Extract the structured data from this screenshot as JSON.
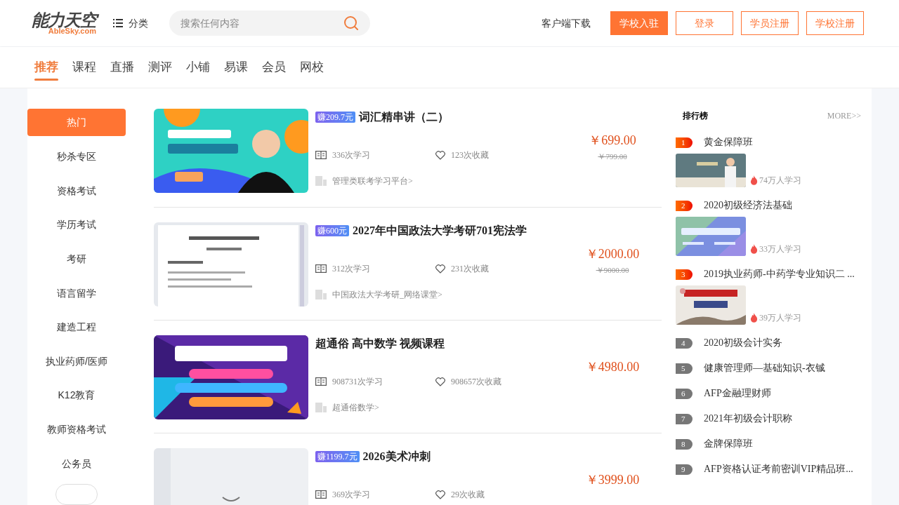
{
  "header": {
    "logo": {
      "name": "能力天空",
      "domain": "AbleSky.com"
    },
    "category_button": "分类",
    "search": {
      "placeholder": "搜索任何内容"
    },
    "download_link": "客户端下载",
    "buttons": [
      {
        "label": "学校入驻",
        "kind": "primary"
      },
      {
        "label": "登录",
        "kind": "outline"
      },
      {
        "label": "学员注册",
        "kind": "outline"
      },
      {
        "label": "学校注册",
        "kind": "outline"
      }
    ]
  },
  "nav_tabs": [
    {
      "label": "推荐",
      "selected": true
    },
    {
      "label": "课程",
      "selected": false
    },
    {
      "label": "直播",
      "selected": false
    },
    {
      "label": "测评",
      "selected": false
    },
    {
      "label": "小铺",
      "selected": false
    },
    {
      "label": "易课",
      "selected": false
    },
    {
      "label": "会员",
      "selected": false
    },
    {
      "label": "网校",
      "selected": false
    }
  ],
  "sidebar": {
    "items": [
      {
        "label": "热门",
        "selected": true
      },
      {
        "label": "秒杀专区",
        "selected": false
      },
      {
        "label": "资格考试",
        "selected": false
      },
      {
        "label": "学历考试",
        "selected": false
      },
      {
        "label": "考研",
        "selected": false
      },
      {
        "label": "语言留学",
        "selected": false
      },
      {
        "label": "建造工程",
        "selected": false
      },
      {
        "label": "执业药师/医师",
        "selected": false
      },
      {
        "label": "K12教育",
        "selected": false
      },
      {
        "label": "教师资格考试",
        "selected": false
      },
      {
        "label": "公务员",
        "selected": false
      }
    ]
  },
  "courses": [
    {
      "earn_badge": "赚209.7元",
      "title": "词汇精串讲（二）",
      "learners": "336次学习",
      "favorites": "123次收藏",
      "price": "￥699.00",
      "original_price": "￥799.00",
      "store": "管理类联考学习平台>"
    },
    {
      "earn_badge": "赚600元",
      "title": "2027年中国政法大学考研701宪法学",
      "learners": "312次学习",
      "favorites": "231次收藏",
      "price": "￥2000.00",
      "original_price": "￥9000.00",
      "store": "中国政法大学考研_网络课堂>"
    },
    {
      "title": "超通俗 高中数学 视频课程",
      "learners": "908731次学习",
      "favorites": "908657次收藏",
      "price": "￥4980.00",
      "store": "超通俗数学>"
    },
    {
      "earn_badge": "赚1199.7元",
      "title": "2026美术冲刺",
      "learners": "369次学习",
      "favorites": "29次收藏",
      "price": "￥3999.00"
    }
  ],
  "ranking": {
    "title": "排行榜",
    "more_link": "MORE>>",
    "items": [
      {
        "rank": "1",
        "kind": "featured",
        "title": "黄金保障班",
        "learners": "74万人学习"
      },
      {
        "rank": "2",
        "kind": "featured",
        "title": "2020初级经济法基础",
        "learners": "33万人学习"
      },
      {
        "rank": "3",
        "kind": "featured",
        "title": "2019执业药师-中药学专业知识二 ...",
        "learners": "39万人学习"
      },
      {
        "rank": "4",
        "kind": "plain",
        "title": "2020初级会计实务"
      },
      {
        "rank": "5",
        "kind": "plain",
        "title": "健康管理师—基础知识-衣铖"
      },
      {
        "rank": "6",
        "kind": "plain",
        "title": "AFP金融理财师"
      },
      {
        "rank": "7",
        "kind": "plain",
        "title": "2021年初级会计职称"
      },
      {
        "rank": "8",
        "kind": "plain",
        "title": "金牌保障班"
      },
      {
        "rank": "9",
        "kind": "plain",
        "title": "AFP资格认证考前密训VIP精品班..."
      }
    ]
  }
}
